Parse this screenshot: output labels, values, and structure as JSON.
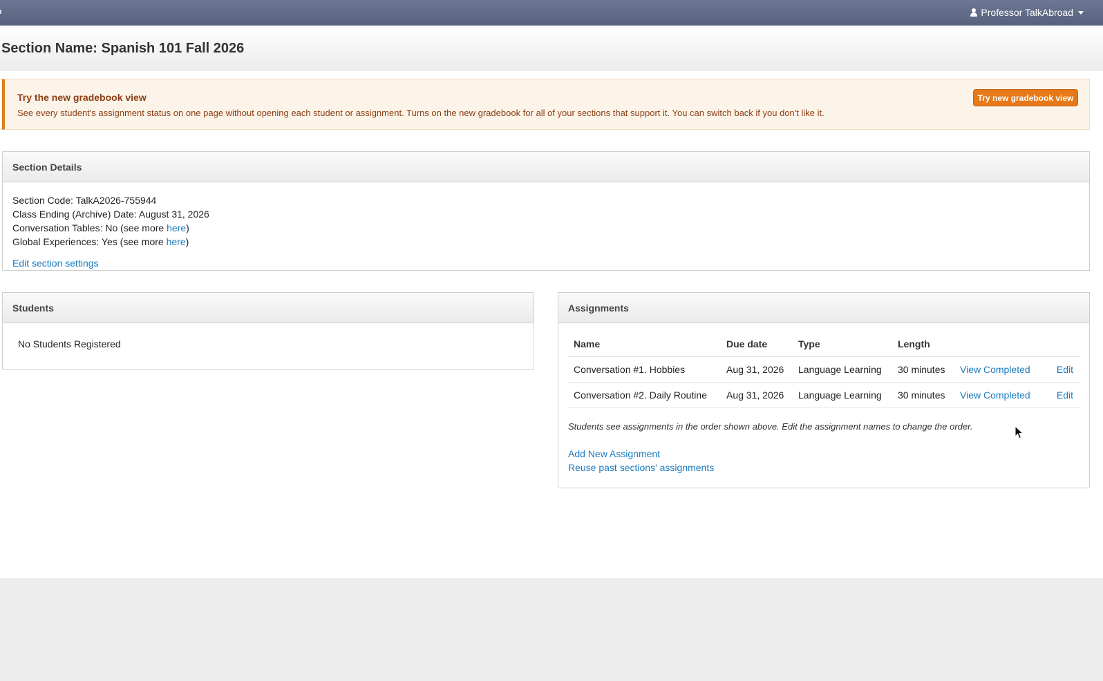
{
  "topbar": {
    "user_name": "Professor TalkAbroad"
  },
  "page": {
    "title": "Section Name: Spanish 101 Fall 2026"
  },
  "alert": {
    "title": "Try the new gradebook view",
    "text": "See every student's assignment status on one page without opening each student or assignment. Turns on the new gradebook for all of your sections that support it. You can switch back if you don't like it.",
    "button_label": "Try new gradebook view",
    "accent_color": "#e67919"
  },
  "section_details": {
    "heading": "Section Details",
    "section_code": "Section Code: TalkA2026-755944",
    "archive_date": "Class Ending (Archive) Date: August 31, 2026",
    "conversation_tables_prefix": "Conversation Tables: No (see more ",
    "global_experiences_prefix": "Global Experiences: Yes (see more ",
    "here_link": "here",
    "close_paren": ")",
    "edit_link": "Edit section settings"
  },
  "students": {
    "heading": "Students",
    "empty_text": "No Students Registered"
  },
  "assignments": {
    "heading": "Assignments",
    "columns": [
      "Name",
      "Due date",
      "Type",
      "Length"
    ],
    "rows": [
      {
        "name": "Conversation #1. Hobbies",
        "due": "Aug 31, 2026",
        "type": "Language Learning",
        "length": "30 minutes",
        "view": "View Completed",
        "edit": "Edit"
      },
      {
        "name": "Conversation #2. Daily Routine",
        "due": "Aug 31, 2026",
        "type": "Language Learning",
        "length": "30 minutes",
        "view": "View Completed",
        "edit": "Edit"
      }
    ],
    "note": "Students see assignments in the order shown above. Edit the assignment names to change the order.",
    "add_link": "Add New Assignment",
    "reuse_link": "Reuse past sections' assignments"
  },
  "colors": {
    "link": "#1a7bbf",
    "navbar": "#5f6b87"
  }
}
